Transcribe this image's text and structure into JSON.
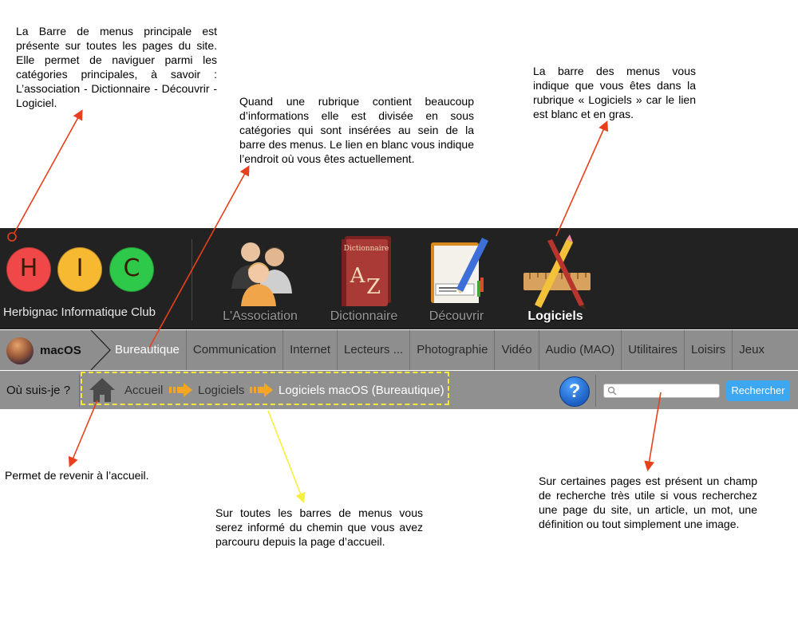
{
  "annotations": {
    "top_left": "La Barre de menus principale est présente sur toutes les pages du site. Elle permet de naviguer parmi les catégories principales, à savoir : L’association - Dictionnaire - Découvrir - Logiciel.",
    "middle": "Quand une rubrique contient beaucoup d’informations elle est divisée en sous catégories qui sont insérées au sein de la barre des menus. Le lien en blanc vous indique l’endroit où vous êtes actuellement.",
    "top_right": "La barre des menus vous indique que vous êtes dans la rubrique « Logiciels » car le lien est blanc et en gras.",
    "bottom_left": "Permet de revenir à l’accueil.",
    "bottom_middle": "Sur toutes les barres de menus vous serez informé du chemin que vous avez parcouru depuis la page d’accueil.",
    "bottom_right": "Sur certaines pages est présent un champ de recherche très utile si vous recherchez une page du site, un article, un mot, une définition ou tout simplement une image."
  },
  "logo": {
    "letters": [
      "H",
      "I",
      "C"
    ],
    "club_name": "Herbignac Informatique Club",
    "colors": [
      "#f04848",
      "#f7b931",
      "#2ec94a"
    ]
  },
  "main_nav": [
    {
      "label": "L'Association",
      "icon": "people-icon"
    },
    {
      "label": "Dictionnaire",
      "icon": "dictionary-icon",
      "icon_text": "Dictionnaire"
    },
    {
      "label": "Découvrir",
      "icon": "book-icon"
    },
    {
      "label": "Logiciels",
      "icon": "app-store-icon",
      "active": true
    }
  ],
  "sub_nav": {
    "section": "macOS",
    "items": [
      "Bureautique",
      "Communication",
      "Internet",
      "Lecteurs ...",
      "Photographie",
      "Vidéo",
      "Audio (MAO)",
      "Utilitaires",
      "Loisirs",
      "Jeux"
    ],
    "active": "Bureautique"
  },
  "breadcrumb": {
    "label": "Où suis-je ?",
    "items": [
      "Accueil",
      "Logiciels",
      "Logiciels macOS (Bureautique)"
    ]
  },
  "help": {
    "label": "?"
  },
  "search": {
    "placeholder": "",
    "button": "Rechercher"
  },
  "colors": {
    "bar_dark": "#222222",
    "bar_grey": "#8e8e8e",
    "annotation_arrow": "#e8401c",
    "breadcrumb_highlight": "#f5e83c",
    "search_button": "#3ea7f1"
  }
}
